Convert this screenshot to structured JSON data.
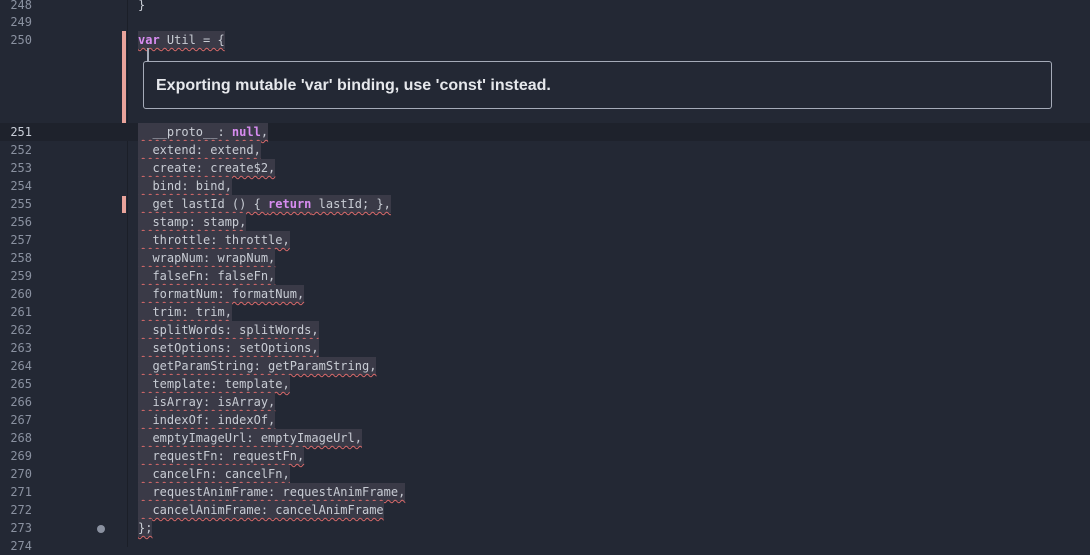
{
  "gutter": {
    "line_numbers": [
      "248",
      "249",
      "250",
      "251",
      "252",
      "253",
      "254",
      "255",
      "256",
      "257",
      "258",
      "259",
      "260",
      "261",
      "262",
      "263",
      "264",
      "265",
      "266",
      "267",
      "268",
      "269",
      "270",
      "271",
      "272",
      "273",
      "274"
    ]
  },
  "code": {
    "line_248": "}",
    "line_250_kw": "var",
    "line_250_rest": " Util = {",
    "line_251_pre": "  __proto__: ",
    "line_251_kw": "null",
    "line_251_post": ",",
    "line_252": "  extend: extend,",
    "line_253": "  create: create$2,",
    "line_254": "  bind: bind,",
    "line_255_pre": "  get lastId () { ",
    "line_255_kw": "return",
    "line_255_post": " lastId; },",
    "line_256": "  stamp: stamp,",
    "line_257": "  throttle: throttle,",
    "line_258": "  wrapNum: wrapNum,",
    "line_259": "  falseFn: falseFn,",
    "line_260": "  formatNum: formatNum,",
    "line_261": "  trim: trim,",
    "line_262": "  splitWords: splitWords,",
    "line_263": "  setOptions: setOptions,",
    "line_264": "  getParamString: getParamString,",
    "line_265": "  template: template,",
    "line_266": "  isArray: isArray,",
    "line_267": "  indexOf: indexOf,",
    "line_268": "  emptyImageUrl: emptyImageUrl,",
    "line_269": "  requestFn: requestFn,",
    "line_270": "  cancelFn: cancelFn,",
    "line_271": "  requestAnimFrame: requestAnimFrame,",
    "line_272": "  cancelAnimFrame: cancelAnimFrame",
    "line_273": "};"
  },
  "diagnostic": {
    "message": "Exporting mutable 'var' binding, use 'const' instead."
  },
  "colors": {
    "background": "#232834",
    "keyword": "#d78cf0",
    "squiggle": "#d96a6a",
    "marker": "#e8a39b"
  }
}
